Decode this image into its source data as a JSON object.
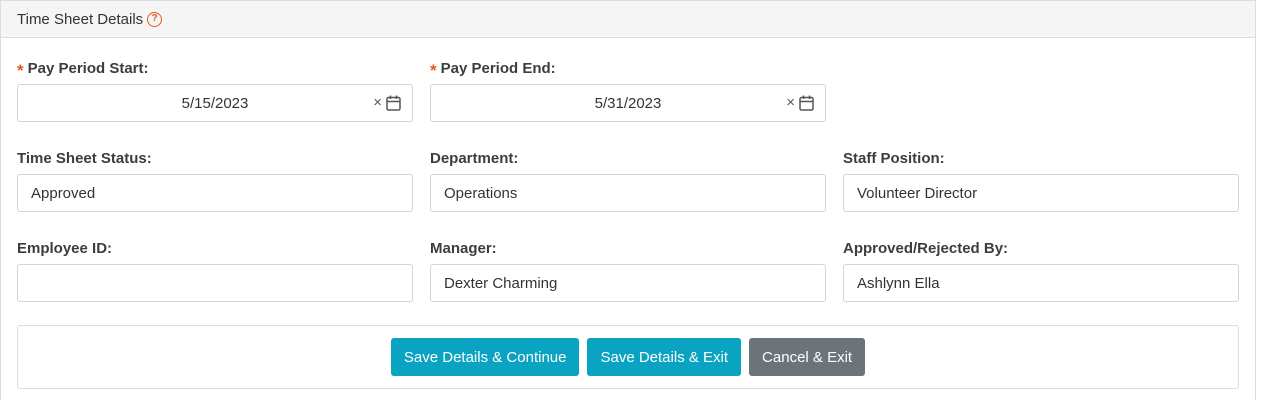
{
  "panel": {
    "title": "Time Sheet Details",
    "help_icon": "question-circle-icon",
    "help_glyph": "?"
  },
  "fields": {
    "pay_period_start": {
      "label": "Pay Period Start:",
      "required": true,
      "value": "5/15/2023"
    },
    "pay_period_end": {
      "label": "Pay Period End:",
      "required": true,
      "value": "5/31/2023"
    },
    "time_sheet_status": {
      "label": "Time Sheet Status:",
      "value": "Approved"
    },
    "department": {
      "label": "Department:",
      "value": "Operations"
    },
    "staff_position": {
      "label": "Staff Position:",
      "value": "Volunteer Director"
    },
    "employee_id": {
      "label": "Employee ID:",
      "value": ""
    },
    "manager": {
      "label": "Manager:",
      "value": "Dexter Charming"
    },
    "approved_rejected_by": {
      "label": "Approved/Rejected By:",
      "value": "Ashlynn Ella"
    }
  },
  "required_marker": "*",
  "clear_glyph": "×",
  "buttons": {
    "save_continue": "Save Details & Continue",
    "save_exit": "Save Details & Exit",
    "cancel_exit": "Cancel & Exit"
  },
  "colors": {
    "primary": "#0aa3c2",
    "secondary": "#6c737a",
    "required": "#e05a1e"
  }
}
